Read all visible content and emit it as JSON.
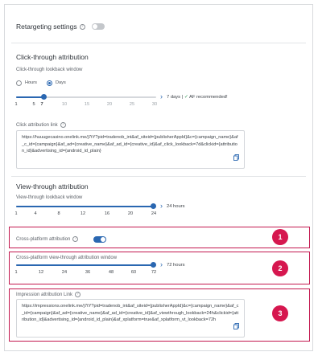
{
  "retargeting": {
    "label": "Retargeting settings",
    "help": "?",
    "toggle_on": false
  },
  "click": {
    "section_title": "Click-through attribution",
    "window_label": "Click-through lookback window",
    "unit_options": [
      "Hours",
      "Days"
    ],
    "selected_unit": "Days",
    "ticks": [
      "1",
      "5",
      "7",
      "10",
      "15",
      "20",
      "25",
      "30"
    ],
    "value_fraction": 0.2,
    "value_text": "7 days |",
    "recommended_text": "AF recommended!",
    "link_label": "Click attribution link",
    "link_value": "https://huuugecasino.onelink.me/j7tY?pid=tradenob_int&af_siteid={publisherAppId}&c={campaign_name}&af_c_id={campaign}&af_ad={creative_name}&af_ad_id={creative_id}&af_click_lookback=7d&clickid={attribution_id}&advertising_id={android_id_plain}"
  },
  "view": {
    "section_title": "View-through attribution",
    "window_label": "View-through lookback window",
    "ticks": [
      "1",
      "4",
      "8",
      "12",
      "16",
      "20",
      "24"
    ],
    "value_fraction": 1.0,
    "value_text": "24 hours"
  },
  "cross_platform": {
    "label": "Cross-platform attribution",
    "toggle_on": true
  },
  "cp_window": {
    "label": "Cross-platform view-through attribution window",
    "ticks": [
      "1",
      "12",
      "24",
      "36",
      "48",
      "60",
      "72"
    ],
    "value_fraction": 1.0,
    "value_text": "72 hours"
  },
  "impression": {
    "label": "Impression attribution Link",
    "link_value": "https://impressions.onelink.me/j7tY?pid=tradenob_int&af_siteid={publisherAppId}&c={campaign_name}&af_c_id={campaign}&af_ad={creative_name}&af_ad_id={creative_id}&af_viewthrough_lookback=24h&clickid={attribution_id}&advertising_id={android_id_plain}&af_xplatform=true&af_xplatform_vt_lookback=72h"
  },
  "badges": [
    "1",
    "2",
    "3"
  ],
  "colors": {
    "accent": "#2a67b1",
    "highlight": "#c3184f",
    "badge": "#d6174f",
    "success": "#3b9b5c"
  },
  "icons": [
    "help-icon",
    "copy-icon",
    "chevron-right-icon",
    "check-icon"
  ]
}
